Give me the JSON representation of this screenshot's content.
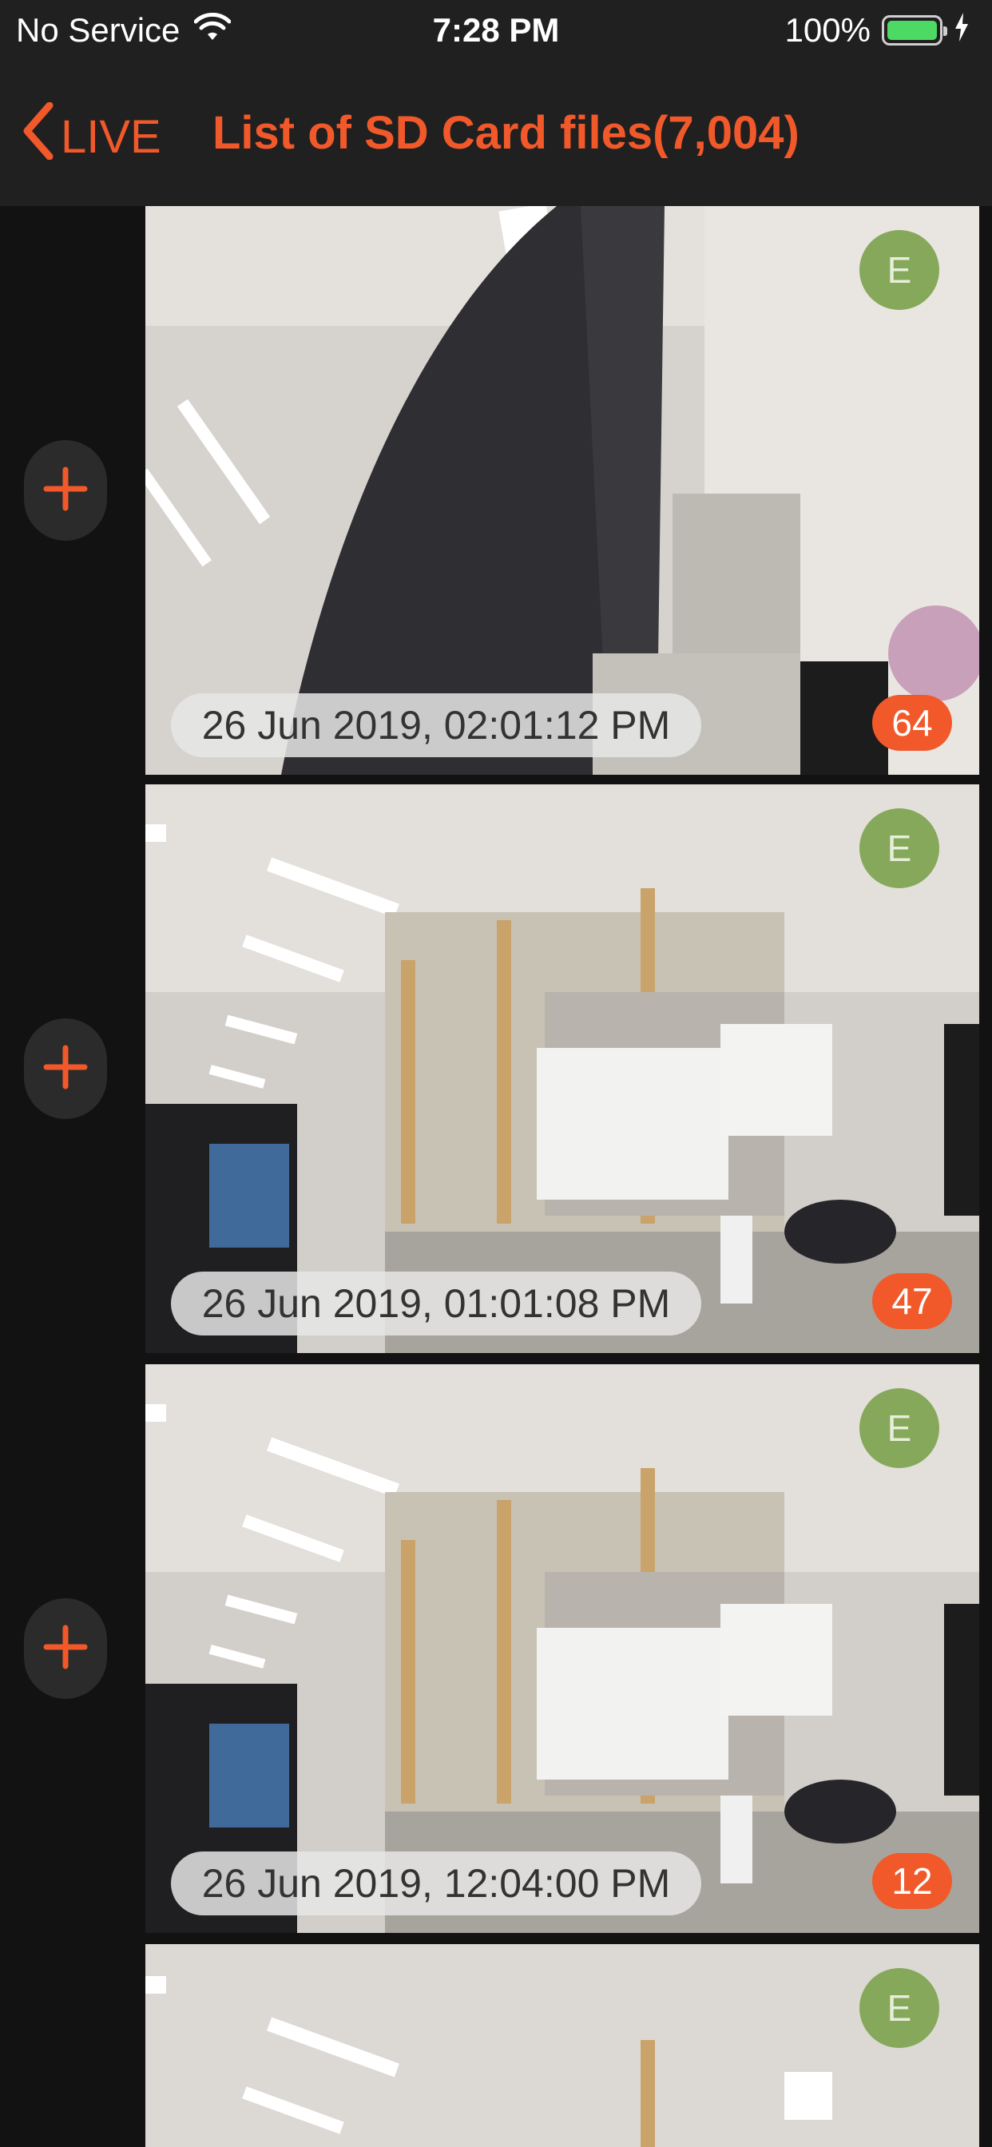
{
  "status_bar": {
    "carrier": "No Service",
    "wifi_icon": "wifi-icon",
    "time": "7:28 PM",
    "battery_percent": "100%",
    "battery_icon": "battery-icon",
    "charging_icon": "bolt-icon"
  },
  "nav": {
    "back_label": "LIVE",
    "back_icon": "chevron-left-icon",
    "title": "List of SD Card files(7,004)"
  },
  "colors": {
    "accent": "#f1592a",
    "event_badge": "#86a85a",
    "background": "#121212",
    "bar": "#202020"
  },
  "recordings": [
    {
      "event": "E",
      "timestamp": "26 Jun 2019, 02:01:12 PM",
      "count": "64",
      "add_icon": "plus-icon"
    },
    {
      "event": "E",
      "timestamp": "26 Jun 2019, 01:01:08 PM",
      "count": "47",
      "add_icon": "plus-icon"
    },
    {
      "event": "E",
      "timestamp": "26 Jun 2019, 12:04:00 PM",
      "count": "12",
      "add_icon": "plus-icon"
    },
    {
      "event": "E",
      "timestamp": "",
      "count": "",
      "add_icon": "plus-icon"
    }
  ]
}
